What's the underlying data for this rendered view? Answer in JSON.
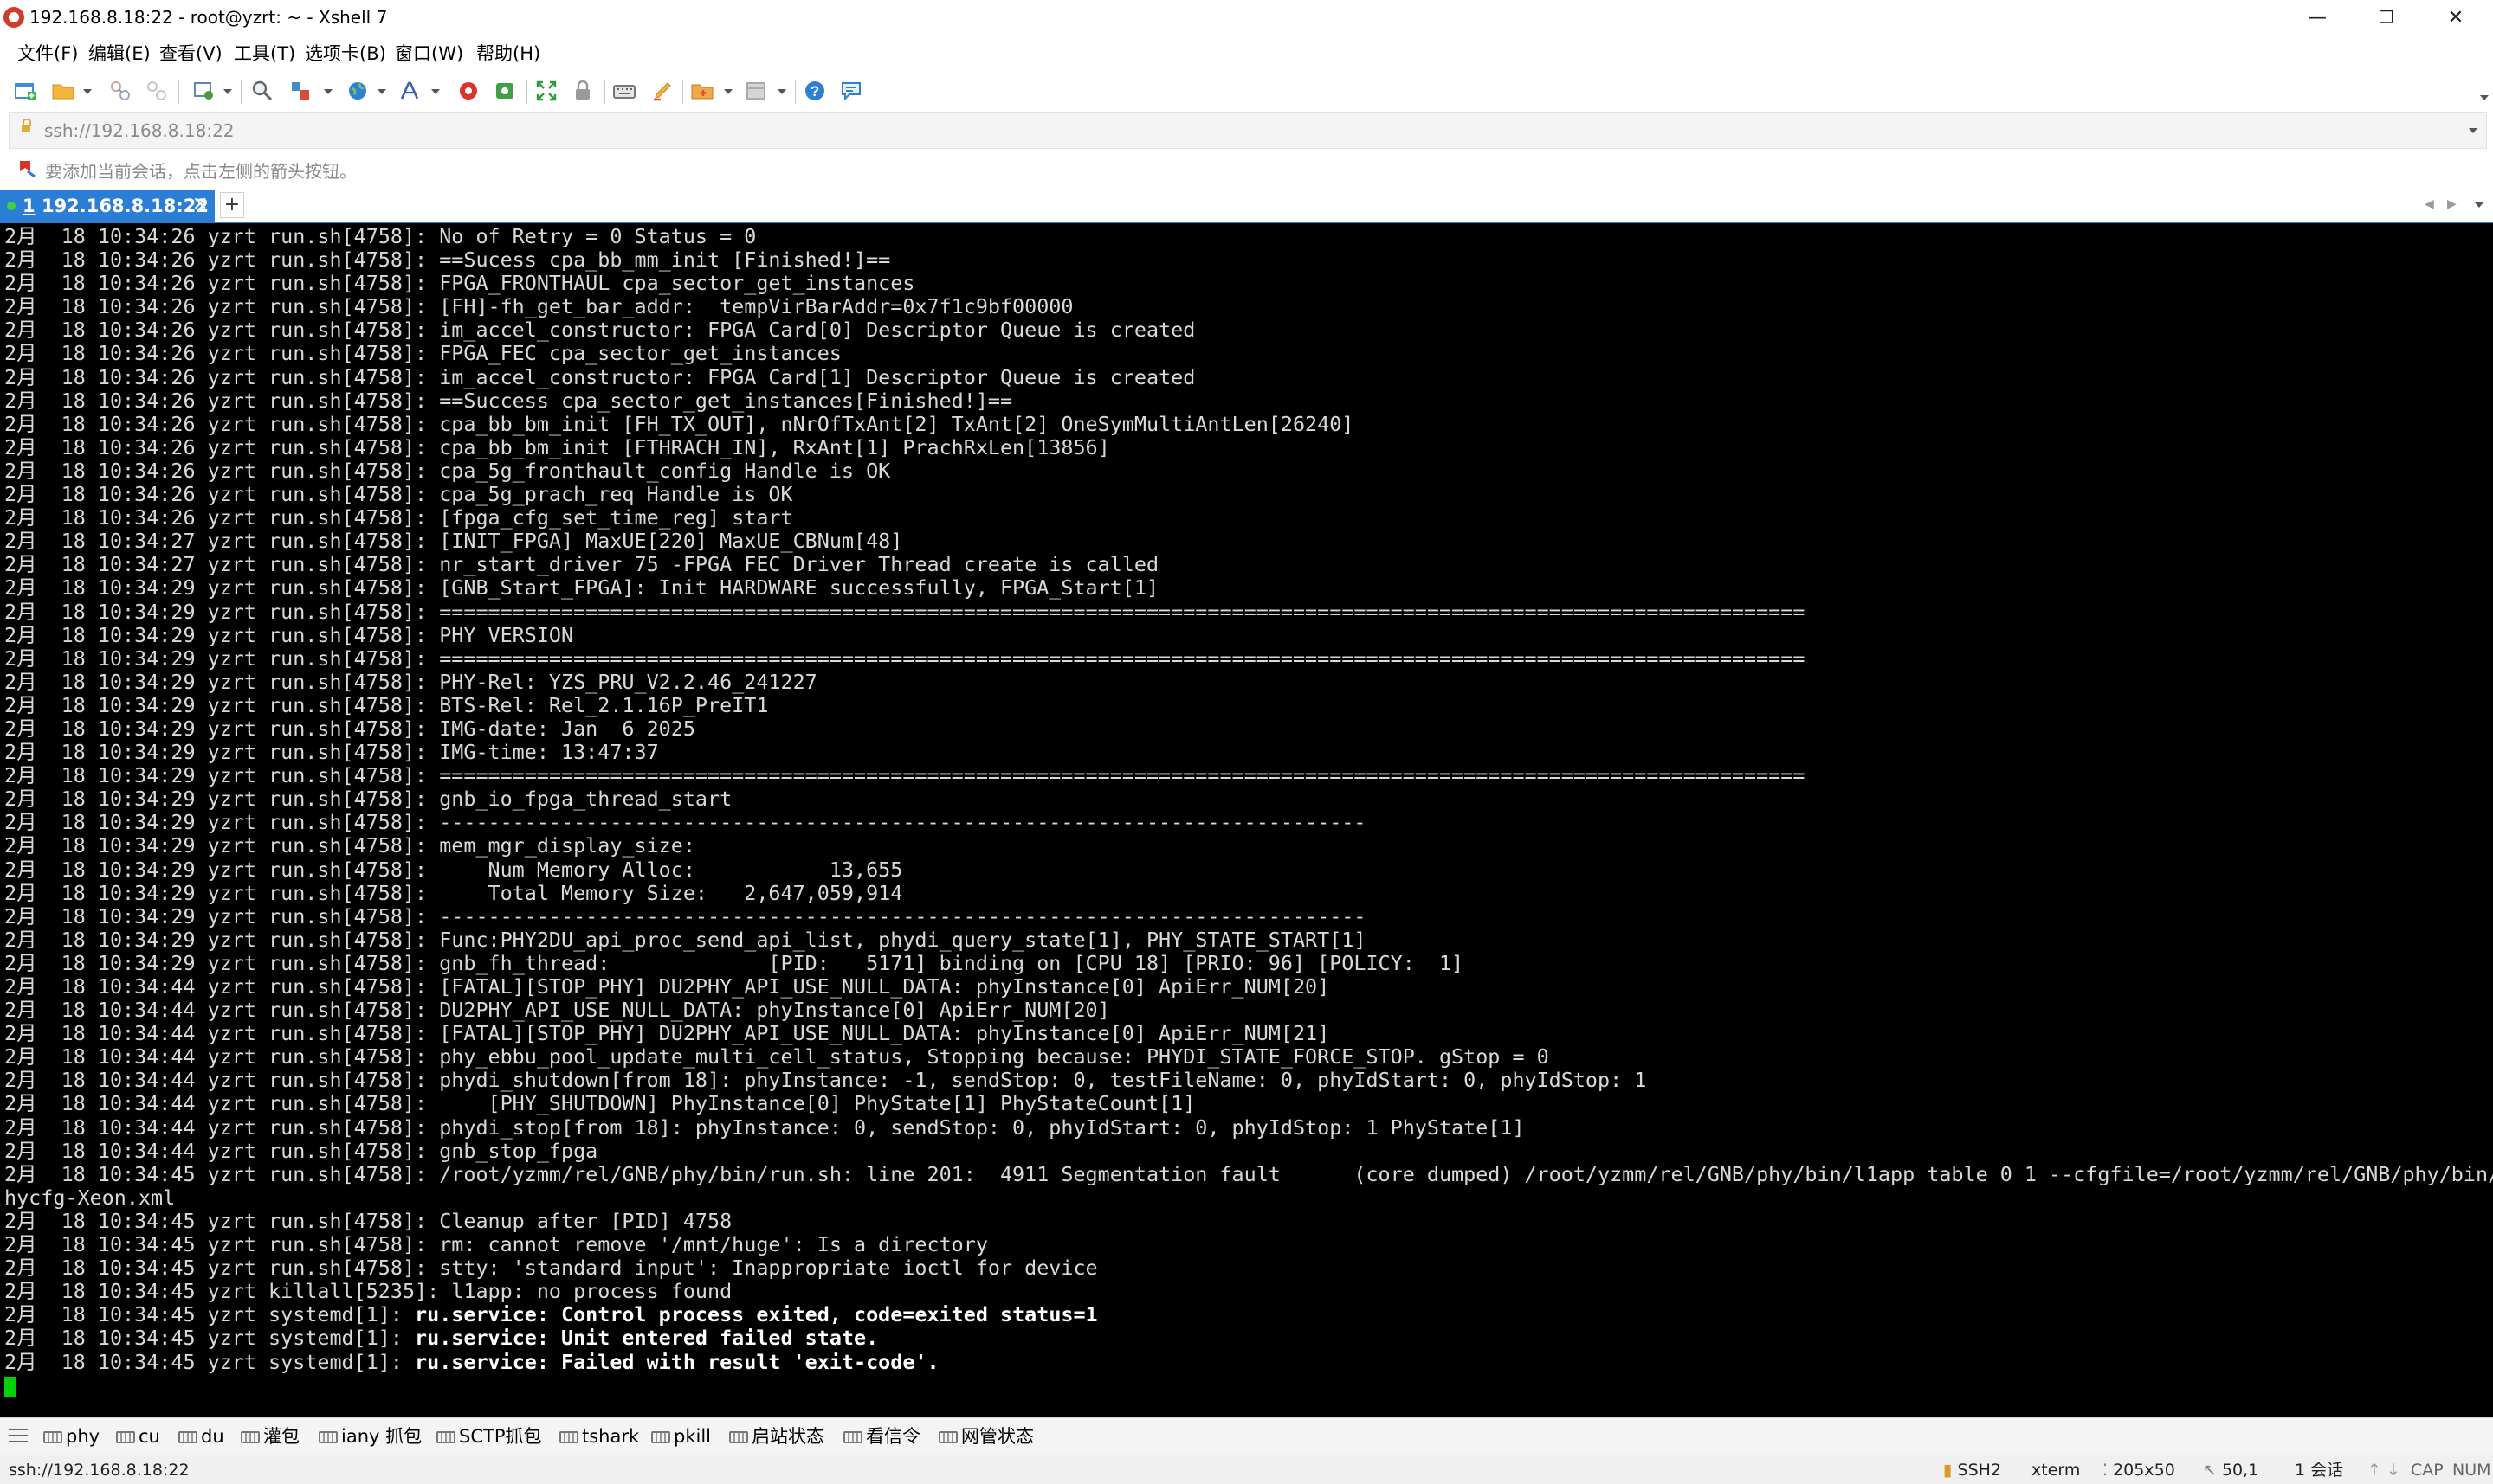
{
  "window": {
    "title": "192.168.8.18:22 - root@yzrt: ~ - Xshell 7",
    "minimize": "—",
    "maximize": "❐",
    "close": "✕"
  },
  "menu": [
    "文件(F)",
    "编辑(E)",
    "查看(V)",
    "工具(T)",
    "选项卡(B)",
    "窗口(W)",
    "帮助(H)"
  ],
  "toolbar": {
    "icons": [
      "new-session-icon",
      "open-folder-icon",
      "reconnect-icon",
      "disconnect-icon",
      "properties-icon",
      "find-icon",
      "transfer-icon",
      "globe-icon",
      "font-icon",
      "xftp-icon",
      "xmanager-icon",
      "fullscreen-icon",
      "lock-icon",
      "keyboard-icon",
      "script-icon",
      "compose-icon",
      "layout-icon",
      "help-icon",
      "chat-icon"
    ]
  },
  "address": {
    "url": "ssh://192.168.8.18:22"
  },
  "hint": {
    "text": "要添加当前会话，点击左侧的箭头按钮。"
  },
  "tabs": [
    {
      "number": "1",
      "label": "192.168.8.18:22",
      "close": "✕"
    }
  ],
  "tab_add": "+",
  "terminal": {
    "colors": {
      "background": "#000000",
      "foreground": "#d9d9d9",
      "cursor": "#00d100"
    },
    "lines": [
      {
        "text": "2月  18 10:34:26 yzrt run.sh[4758]: No of Retry = 0 Status = 0",
        "bold": false
      },
      {
        "text": "2月  18 10:34:26 yzrt run.sh[4758]: ==Sucess cpa_bb_mm_init [Finished!]==",
        "bold": false
      },
      {
        "text": "2月  18 10:34:26 yzrt run.sh[4758]: FPGA_FRONTHAUL cpa_sector_get_instances",
        "bold": false
      },
      {
        "text": "2月  18 10:34:26 yzrt run.sh[4758]: [FH]-fh_get_bar_addr:  tempVirBarAddr=0x7f1c9bf00000",
        "bold": false
      },
      {
        "text": "2月  18 10:34:26 yzrt run.sh[4758]: im_accel_constructor: FPGA Card[0] Descriptor Queue is created",
        "bold": false
      },
      {
        "text": "2月  18 10:34:26 yzrt run.sh[4758]: FPGA_FEC cpa_sector_get_instances",
        "bold": false
      },
      {
        "text": "2月  18 10:34:26 yzrt run.sh[4758]: im_accel_constructor: FPGA Card[1] Descriptor Queue is created",
        "bold": false
      },
      {
        "text": "2月  18 10:34:26 yzrt run.sh[4758]: ==Success cpa_sector_get_instances[Finished!]==",
        "bold": false
      },
      {
        "text": "2月  18 10:34:26 yzrt run.sh[4758]: cpa_bb_bm_init [FH_TX_OUT], nNrOfTxAnt[2] TxAnt[2] OneSymMultiAntLen[26240]",
        "bold": false
      },
      {
        "text": "2月  18 10:34:26 yzrt run.sh[4758]: cpa_bb_bm_init [FTHRACH_IN], RxAnt[1] PrachRxLen[13856]",
        "bold": false
      },
      {
        "text": "2月  18 10:34:26 yzrt run.sh[4758]: cpa_5g_fronthault_config Handle is OK",
        "bold": false
      },
      {
        "text": "2月  18 10:34:26 yzrt run.sh[4758]: cpa_5g_prach_req Handle is OK",
        "bold": false
      },
      {
        "text": "2月  18 10:34:26 yzrt run.sh[4758]: [fpga_cfg_set_time_reg] start",
        "bold": false
      },
      {
        "text": "2月  18 10:34:27 yzrt run.sh[4758]: [INIT_FPGA] MaxUE[220] MaxUE_CBNum[48]",
        "bold": false
      },
      {
        "text": "2月  18 10:34:27 yzrt run.sh[4758]: nr_start_driver 75 -FPGA FEC Driver Thread create is called",
        "bold": false
      },
      {
        "text": "2月  18 10:34:29 yzrt run.sh[4758]: [GNB_Start_FPGA]: Init HARDWARE successfully, FPGA_Start[1]",
        "bold": false
      },
      {
        "text": "2月  18 10:34:29 yzrt run.sh[4758]: ================================================================================================================",
        "bold": false
      },
      {
        "text": "2月  18 10:34:29 yzrt run.sh[4758]: PHY VERSION",
        "bold": false
      },
      {
        "text": "2月  18 10:34:29 yzrt run.sh[4758]: ================================================================================================================",
        "bold": false
      },
      {
        "text": "2月  18 10:34:29 yzrt run.sh[4758]: PHY-Rel: YZS_PRU_V2.2.46_241227",
        "bold": false
      },
      {
        "text": "2月  18 10:34:29 yzrt run.sh[4758]: BTS-Rel: Rel_2.1.16P_PreIT1",
        "bold": false
      },
      {
        "text": "2月  18 10:34:29 yzrt run.sh[4758]: IMG-date: Jan  6 2025",
        "bold": false
      },
      {
        "text": "2月  18 10:34:29 yzrt run.sh[4758]: IMG-time: 13:47:37",
        "bold": false
      },
      {
        "text": "2月  18 10:34:29 yzrt run.sh[4758]: ================================================================================================================",
        "bold": false
      },
      {
        "text": "2月  18 10:34:29 yzrt run.sh[4758]: gnb_io_fpga_thread_start",
        "bold": false
      },
      {
        "text": "2月  18 10:34:29 yzrt run.sh[4758]: ----------------------------------------------------------------------------",
        "bold": false
      },
      {
        "text": "2月  18 10:34:29 yzrt run.sh[4758]: mem_mgr_display_size:",
        "bold": false
      },
      {
        "text": "2月  18 10:34:29 yzrt run.sh[4758]:     Num Memory Alloc:           13,655",
        "bold": false
      },
      {
        "text": "2月  18 10:34:29 yzrt run.sh[4758]:     Total Memory Size:   2,647,059,914",
        "bold": false
      },
      {
        "text": "2月  18 10:34:29 yzrt run.sh[4758]: ----------------------------------------------------------------------------",
        "bold": false
      },
      {
        "text": "2月  18 10:34:29 yzrt run.sh[4758]: Func:PHY2DU_api_proc_send_api_list, phydi_query_state[1], PHY_STATE_START[1]",
        "bold": false
      },
      {
        "text": "2月  18 10:34:29 yzrt run.sh[4758]: gnb_fh_thread:             [PID:   5171] binding on [CPU 18] [PRIO: 96] [POLICY:  1]",
        "bold": false
      },
      {
        "text": "2月  18 10:34:44 yzrt run.sh[4758]: [FATAL][STOP_PHY] DU2PHY_API_USE_NULL_DATA: phyInstance[0] ApiErr_NUM[20]",
        "bold": false
      },
      {
        "text": "2月  18 10:34:44 yzrt run.sh[4758]: DU2PHY_API_USE_NULL_DATA: phyInstance[0] ApiErr_NUM[20]",
        "bold": false
      },
      {
        "text": "2月  18 10:34:44 yzrt run.sh[4758]: [FATAL][STOP_PHY] DU2PHY_API_USE_NULL_DATA: phyInstance[0] ApiErr_NUM[21]",
        "bold": false
      },
      {
        "text": "2月  18 10:34:44 yzrt run.sh[4758]: phy_ebbu_pool_update_multi_cell_status, Stopping because: PHYDI_STATE_FORCE_STOP. gStop = 0",
        "bold": false
      },
      {
        "text": "2月  18 10:34:44 yzrt run.sh[4758]: phydi_shutdown[from 18]: phyInstance: -1, sendStop: 0, testFileName: 0, phyIdStart: 0, phyIdStop: 1",
        "bold": false
      },
      {
        "text": "2月  18 10:34:44 yzrt run.sh[4758]:     [PHY_SHUTDOWN] PhyInstance[0] PhyState[1] PhyStateCount[1]",
        "bold": false
      },
      {
        "text": "2月  18 10:34:44 yzrt run.sh[4758]: phydi_stop[from 18]: phyInstance: 0, sendStop: 0, phyIdStart: 0, phyIdStop: 1 PhyState[1]",
        "bold": false
      },
      {
        "text": "2月  18 10:34:44 yzrt run.sh[4758]: gnb_stop_fpga",
        "bold": false
      },
      {
        "text": "2月  18 10:34:45 yzrt run.sh[4758]: /root/yzmm/rel/GNB/phy/bin/run.sh: line 201:  4911 Segmentation fault      (core dumped) /root/yzmm/rel/GNB/phy/bin/l1app table 0 1 --cfgfile=/root/yzmm/rel/GNB/phy/bin/p",
        "bold": false
      },
      {
        "text": "hycfg-Xeon.xml",
        "bold": false
      },
      {
        "text": "2月  18 10:34:45 yzrt run.sh[4758]: Cleanup after [PID] 4758",
        "bold": false
      },
      {
        "text": "2月  18 10:34:45 yzrt run.sh[4758]: rm: cannot remove '/mnt/huge': Is a directory",
        "bold": false
      },
      {
        "text": "2月  18 10:34:45 yzrt run.sh[4758]: stty: 'standard input': Inappropriate ioctl for device",
        "bold": false
      },
      {
        "text": "2月  18 10:34:45 yzrt killall[5235]: l1app: no process found",
        "bold": false
      },
      {
        "text": "2月  18 10:34:45 yzrt systemd[1]: ",
        "bold_text": "ru.service: Control process exited, code=exited status=1",
        "bold": true
      },
      {
        "text": "2月  18 10:34:45 yzrt systemd[1]: ",
        "bold_text": "ru.service: Unit entered failed state.",
        "bold": true
      },
      {
        "text": "2月  18 10:34:45 yzrt systemd[1]: ",
        "bold_text": "ru.service: Failed with result 'exit-code'.",
        "bold": true
      }
    ]
  },
  "quick_commands": [
    "phy",
    "cu",
    "du",
    "灌包",
    "iany 抓包",
    "SCTP抓包",
    "tshark",
    "pkill",
    "启站状态",
    "看信令",
    "网管状态"
  ],
  "status": {
    "connection": "ssh://192.168.8.18:22",
    "protocol": "SSH2",
    "term": "xterm",
    "size": "205x50",
    "cursor_pos": "50,1",
    "sessions": "1 会话",
    "caps": "CAP",
    "num": "NUM"
  }
}
